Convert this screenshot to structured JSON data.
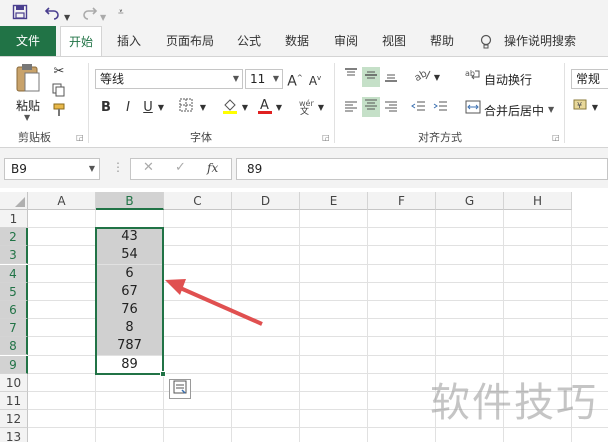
{
  "qat": {
    "save_icon": "save-icon",
    "undo_icon": "undo-icon",
    "redo_icon": "redo-icon",
    "customize_icon": "customize-qat-icon"
  },
  "tabs": {
    "file": "文件",
    "home": "开始",
    "insert": "插入",
    "layout": "页面布局",
    "formulas": "公式",
    "data": "数据",
    "review": "审阅",
    "view": "视图",
    "help": "帮助",
    "tell_me": "操作说明搜索"
  },
  "ribbon": {
    "clipboard": {
      "paste_label": "粘贴",
      "group_label": "剪贴板"
    },
    "font": {
      "font_name": "等线",
      "font_size": "11",
      "bold": "B",
      "italic": "I",
      "underline": "U",
      "group_label": "字体"
    },
    "alignment": {
      "wrap_text": "自动换行",
      "merge_center": "合并后居中",
      "group_label": "对齐方式"
    },
    "number": {
      "format": "常规"
    }
  },
  "formula_bar": {
    "name_box": "B9",
    "cancel": "✕",
    "enter": "✓",
    "fx": "fx",
    "formula": "89"
  },
  "sheet": {
    "columns": [
      "A",
      "B",
      "C",
      "D",
      "E",
      "F",
      "G",
      "H"
    ],
    "rows": [
      "1",
      "2",
      "3",
      "4",
      "5",
      "6",
      "7",
      "8",
      "9",
      "10",
      "11",
      "12",
      "13"
    ],
    "column_b_values": [
      "",
      "43",
      "54",
      "6",
      "67",
      "76",
      "8",
      "787",
      "89"
    ],
    "selection_color": "#217346",
    "arrow_color": "#e05050"
  },
  "watermark": "软件技巧"
}
